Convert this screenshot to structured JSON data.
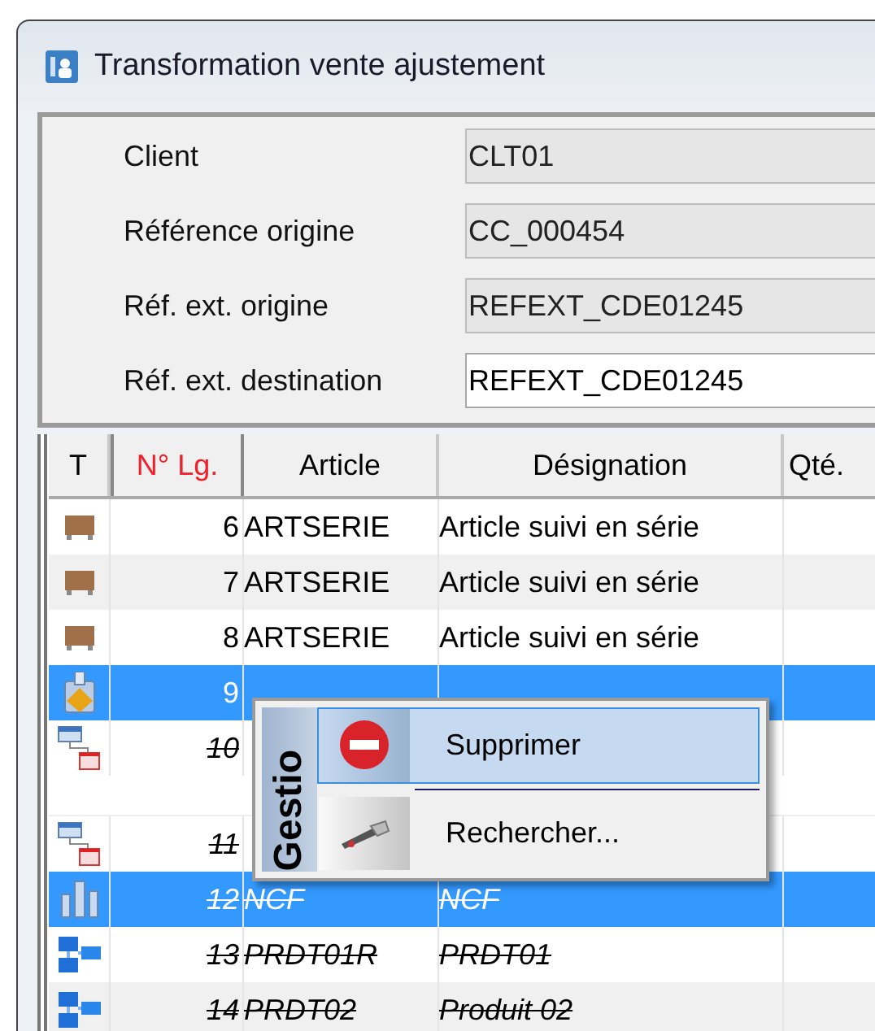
{
  "window": {
    "title": "Transformation vente ajustement"
  },
  "form": [
    {
      "label": "Client",
      "value": "CLT01",
      "readonly": true
    },
    {
      "label": "Référence origine",
      "value": "CC_000454",
      "readonly": true
    },
    {
      "label": "Réf. ext. origine",
      "value": "REFEXT_CDE01245",
      "readonly": true
    },
    {
      "label": "Réf. ext. destination",
      "value": "REFEXT_CDE01245",
      "readonly": false
    }
  ],
  "table": {
    "columns": [
      {
        "label": "T",
        "sorted": false
      },
      {
        "label": "N° Lg.",
        "sorted": true
      },
      {
        "label": "Article",
        "sorted": false
      },
      {
        "label": "Désignation",
        "sorted": false
      },
      {
        "label": "Qté.",
        "sorted": false
      }
    ],
    "rows": [
      {
        "kind": "serial",
        "number": "6",
        "article": "ARTSERIE",
        "designation": "Article suivi en série",
        "struck": false,
        "selected": false
      },
      {
        "kind": "serial",
        "number": "7",
        "article": "ARTSERIE",
        "designation": "Article suivi en série",
        "struck": false,
        "selected": false
      },
      {
        "kind": "serial",
        "number": "8",
        "article": "ARTSERIE",
        "designation": "Article suivi en série",
        "struck": false,
        "selected": false
      },
      {
        "kind": "flask",
        "number": "9",
        "struck": false,
        "selected": true
      },
      {
        "kind": "link",
        "number": "10",
        "struck": true,
        "selected": false
      },
      {
        "kind": "spacer"
      },
      {
        "kind": "link",
        "number": "11",
        "struck": true,
        "selected": false
      },
      {
        "kind": "bars",
        "number": "12",
        "article": "NCF",
        "designation": "NCF",
        "struck": true,
        "selected": true
      },
      {
        "kind": "kit",
        "number": "13",
        "article": "PRDT01R",
        "designation": "PRDT01",
        "struck": true,
        "selected": false
      },
      {
        "kind": "kit",
        "number": "14",
        "article": "PRDT02",
        "designation": "Produit 02",
        "struck": true,
        "selected": false
      }
    ]
  },
  "context_menu": {
    "heading": "Gestio",
    "items": [
      {
        "kind": "delete",
        "label": "Supprimer",
        "selected": true
      },
      {
        "kind": "search",
        "label": "Rechercher...",
        "selected": false
      }
    ]
  }
}
